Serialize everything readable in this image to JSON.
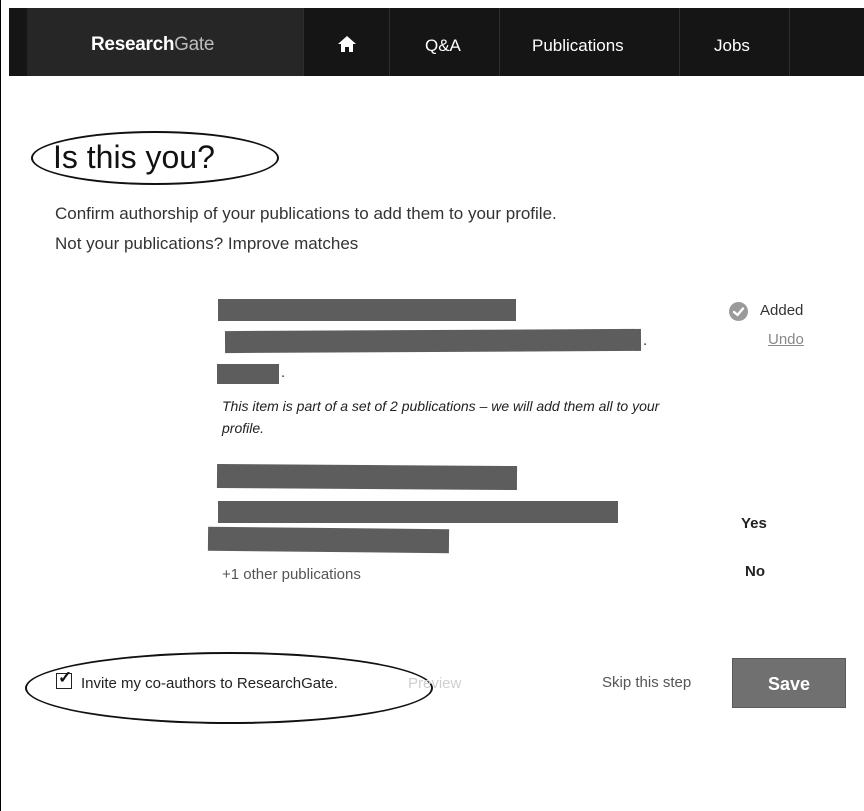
{
  "navbar": {
    "brand_primary": "Research",
    "brand_secondary": "Gate",
    "items": [
      {
        "label": "Q&A"
      },
      {
        "label": "Publications"
      },
      {
        "label": "Jobs"
      }
    ],
    "home_icon": "home-icon"
  },
  "page": {
    "title": "Is this you?",
    "subtitle": "Confirm authorship of your publications to add them to your profile.",
    "subtitle2": "Not your publications? Improve matches"
  },
  "publication_1": {
    "status": "Added",
    "status_icon": "check-circle-icon",
    "undo_label": "Undo",
    "note": "This item is part of a set of 2 publications – we will add them all to your profile."
  },
  "publication_2": {
    "other_count_label": "+1 other publications",
    "yes_label": "Yes",
    "no_label": "No"
  },
  "invite": {
    "checked": true,
    "label": "Invite my co-authors to ResearchGate.",
    "preview_label": "Preview"
  },
  "actions": {
    "skip_label": "Skip this step",
    "save_label": "Save"
  },
  "colors": {
    "navbar_bg": "#151515",
    "save_bg": "#707070",
    "redaction": "#5d5d5d"
  }
}
